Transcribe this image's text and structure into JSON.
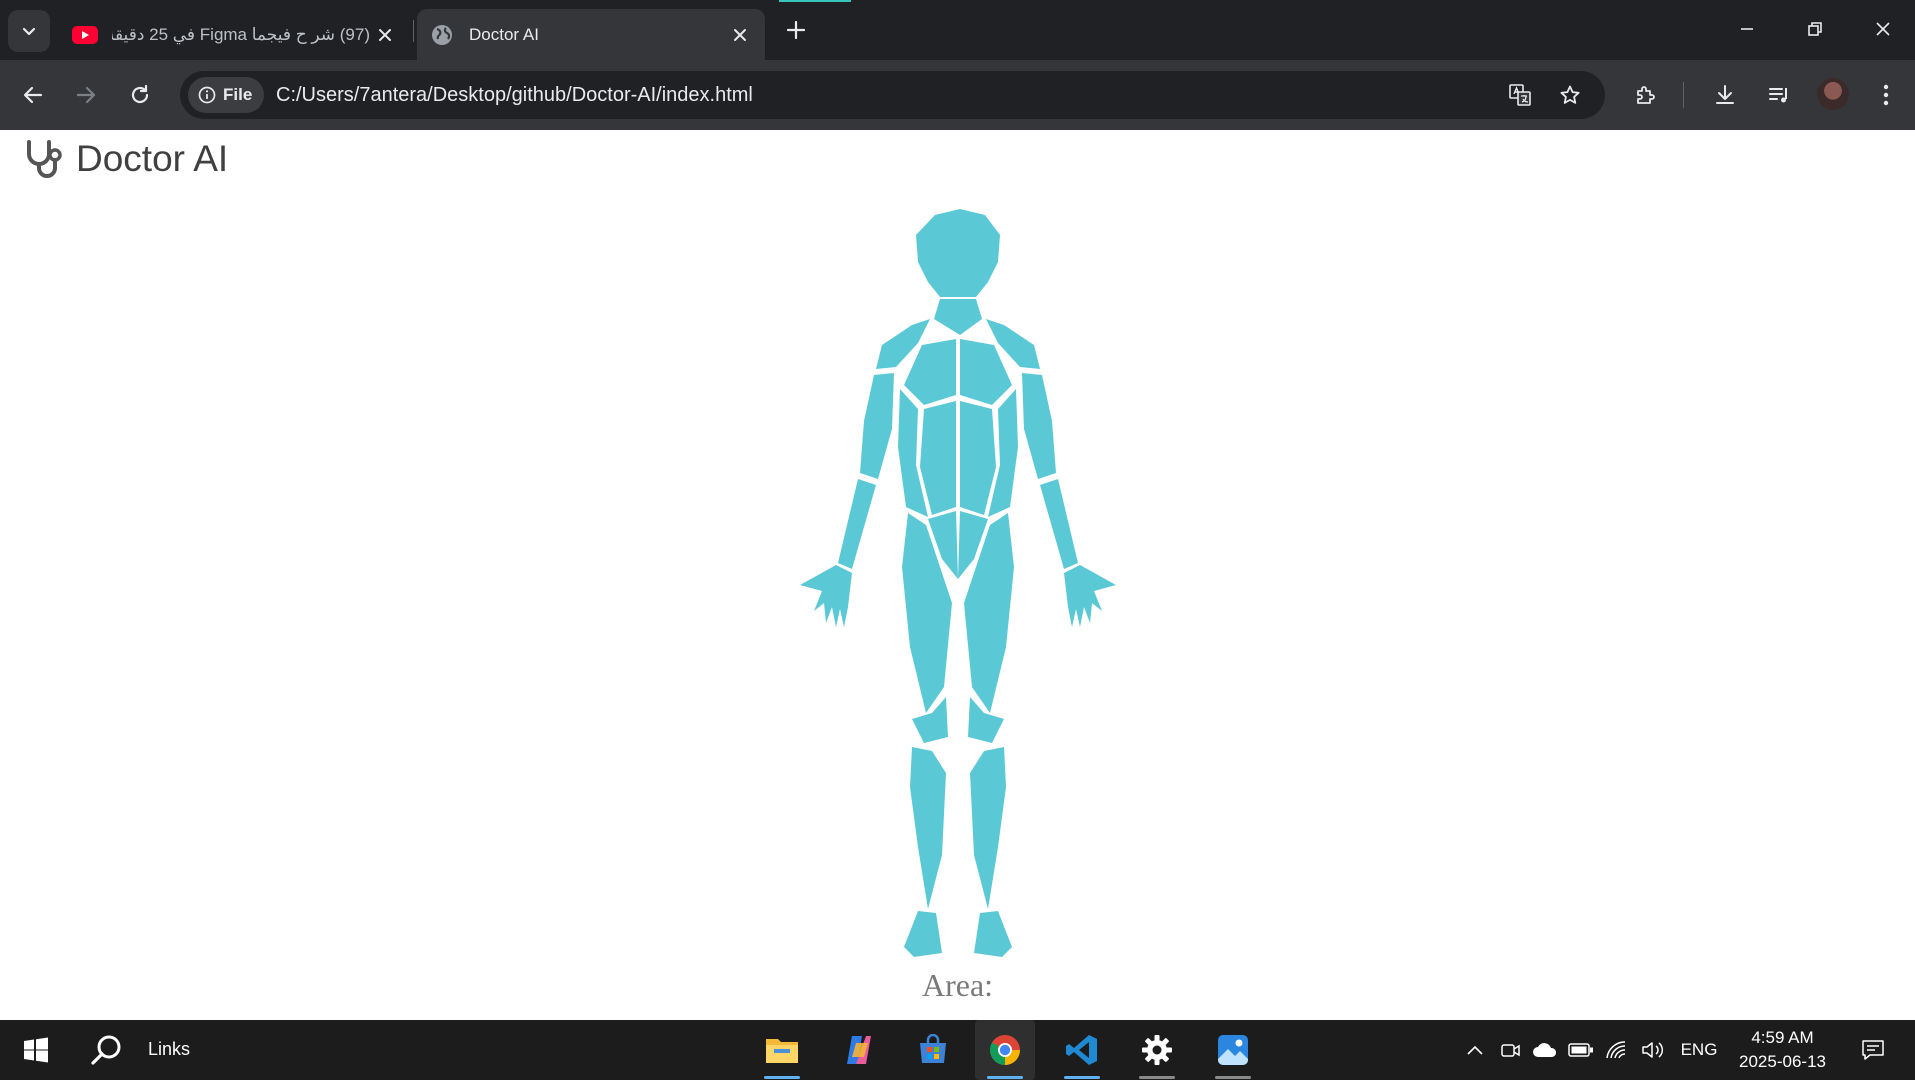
{
  "browser": {
    "tabs": [
      {
        "title": "(97) شر ح فيجما Figma في 25 دقيقة",
        "favicon": "youtube-icon",
        "active": false
      },
      {
        "title": "Doctor AI",
        "favicon": "globe-icon",
        "active": true
      }
    ],
    "address_bar": {
      "chip_label": "File",
      "url": "C:/Users/7antera/Desktop/github/Doctor-AI/index.html"
    },
    "accent_color": "#39c5bb"
  },
  "page": {
    "brand": {
      "title": "Doctor AI",
      "icon": "stethoscope-icon"
    },
    "figure": {
      "description_icon": "human-body-figure",
      "fill_color": "#5bc8d6"
    },
    "area_label": "Area:"
  },
  "taskbar": {
    "search_label": "Links",
    "pinned_apps": [
      "file-explorer-icon",
      "copilot-icon",
      "microsoft-store-icon",
      "chrome-icon",
      "vscode-icon",
      "settings-icon",
      "photos-icon"
    ],
    "tray": {
      "language": "ENG"
    },
    "clock": {
      "time": "4:59 AM",
      "date": "2025-06-13"
    }
  }
}
